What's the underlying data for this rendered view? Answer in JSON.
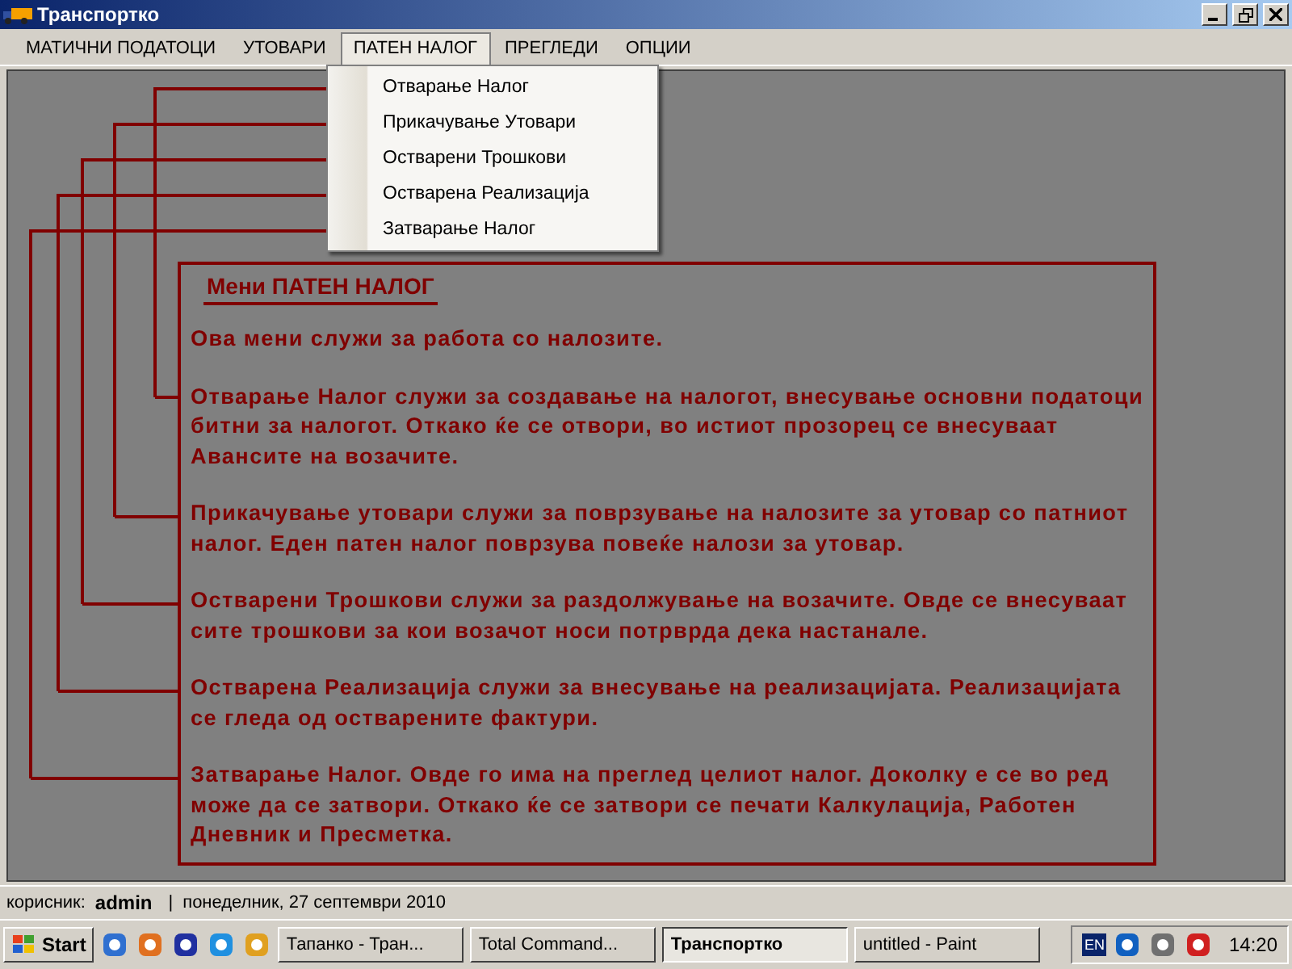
{
  "window": {
    "title": "Транспортко"
  },
  "menu": [
    {
      "label": "МАТИЧНИ ПОДАТОЦИ",
      "selected": false
    },
    {
      "label": "УТОВАРИ",
      "selected": false
    },
    {
      "label": "ПАТЕН НАЛОГ",
      "selected": true
    },
    {
      "label": "ПРЕГЛЕДИ",
      "selected": false
    },
    {
      "label": "ОПЦИИ",
      "selected": false
    }
  ],
  "dropdown": [
    "Отварање Налог",
    "Прикачување Утовари",
    "Остварени Трошкови",
    "Остварена Реализација",
    "Затварање Налог"
  ],
  "help": {
    "title": "Мени ПАТЕН НАЛОГ",
    "intro": "Ова мени служи за работа со налозите.",
    "paragraphs": [
      "Отварање Налог служи за создавање на налогот, внесување основни податоци битни за налогот. Откако ќе се отвори, во истиот прозорец се внесуваат Авансите на возачите.",
      "Прикачување утовари служи за поврзување на налозите за утовар со патниот налог. Еден патен налог поврзува повеќе налози за утовар.",
      "Остварени Трошкови служи за раздолжување на возачите. Овде се внесуваат сите трошкови за кои возачот носи потрврда дека настанале.",
      "Остварена Реализација служи за внесување на реализацијата. Реализацијата се гледа од остварените фактури.",
      "Затварање Налог. Овде го има на преглед целиот налог. Доколку е се во ред може да се затвори. Откако ќе се затвори се печати Калкулација, Работен Дневник и Пресметка."
    ]
  },
  "status_bar": {
    "user_label": "корисник:",
    "user": "admin",
    "separator": "|",
    "date": "понеделник, 27 септември 2010"
  },
  "taskbar": {
    "start": "Start",
    "tasks": [
      {
        "label": "Тапанко - Тран...",
        "selected": false
      },
      {
        "label": "Total Command...",
        "selected": false
      },
      {
        "label": "Транспортко",
        "selected": true
      },
      {
        "label": "untitled - Paint",
        "selected": false
      }
    ],
    "language": "EN",
    "clock": "14:20"
  }
}
